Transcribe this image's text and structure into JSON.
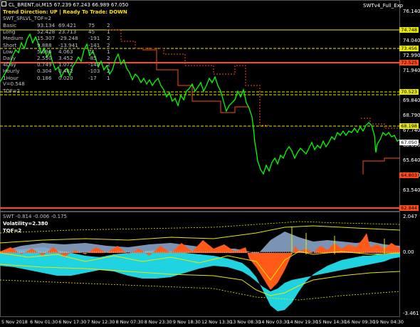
{
  "header": {
    "title": "CL_BRENT,oi,M15  67.239 67.243 66.989 67.050",
    "trend_label": "Trend Direction:",
    "trend_value": "UP",
    "ready_label": "Ready To Trade:",
    "ready_value": "DOWN",
    "indicator_name": "SWTv4_Full_Exp"
  },
  "stats_table": {
    "title": "SWT_SRLVL_TOF=2",
    "rows": [
      [
        "Basic",
        "93.134",
        "69.421",
        "75",
        "2"
      ],
      [
        "Long",
        "52.428",
        "23.713",
        "45",
        "1"
      ],
      [
        "Medium",
        "15.307",
        "-29.248",
        "-191",
        "2"
      ],
      [
        "Short",
        "9.888",
        "-13.941",
        "-141",
        "2"
      ],
      [
        "Low",
        "5.696",
        "4.063",
        "71",
        "1"
      ],
      [
        "Daily",
        "2.550",
        "3.452",
        "-85",
        "2"
      ],
      [
        "4Day",
        "0.749",
        "1.072",
        "-143",
        "2"
      ],
      [
        "Hourly",
        "0.304",
        "0.462",
        "-103",
        "2"
      ],
      [
        "1Hour",
        "0.186",
        "0.020",
        "-17",
        "1"
      ]
    ],
    "v_line": "V=0.548",
    "tof_line": "TOF=2"
  },
  "price_axis": {
    "ticks": [
      "76.140",
      "74.040",
      "72.990",
      "71.940",
      "69.840",
      "68.790",
      "67.740",
      "66.690",
      "65.640",
      "64.590",
      "63.540"
    ],
    "markers": [
      {
        "label": "74.748",
        "color": "#e8e800",
        "text_color": "#000"
      },
      {
        "label": "73.456",
        "color": "#e8e800",
        "text_color": "#000"
      },
      {
        "label": "72.525",
        "color": "#ff4a1a",
        "text_color": "#000"
      },
      {
        "label": "70.523",
        "color": "#e8e800",
        "text_color": "#000"
      },
      {
        "label": "68.198",
        "color": "#e8e800",
        "text_color": "#000"
      },
      {
        "label": "67.050",
        "color": "#ffffff",
        "text_color": "#000"
      },
      {
        "label": "64.803",
        "color": "#ff4a1a",
        "text_color": "#000"
      },
      {
        "label": "62.844",
        "color": "#ff4a1a",
        "text_color": "#000"
      }
    ]
  },
  "indicator": {
    "title": "SWT -0.814 -0.006 -0.175",
    "volatility": "Volatility=2.380",
    "tof": "TOF=2",
    "axis_ticks": [
      "2.047",
      "0.00",
      "-3.461"
    ]
  },
  "time_axis": [
    "5 Nov 2018",
    "6 Nov 01:30",
    "6 Nov 17:30",
    "7 Nov 12:30",
    "8 Nov 07:30",
    "8 Nov 23:30",
    "9 Nov 18:30",
    "12 Nov 13:30",
    "13 Nov 08:30",
    "14 Nov 03:30",
    "14 Nov 19:30",
    "15 Nov 14:30",
    "16 Nov 09:30",
    "19 Nov 04:30"
  ],
  "colors": {
    "price_line": "#00ff00",
    "resist": "#ff4a1a",
    "level_yellow": "#e8e800",
    "cyan": "#1fd3e0",
    "orange": "#ff5a1a",
    "steel": "#8aa4c8"
  }
}
